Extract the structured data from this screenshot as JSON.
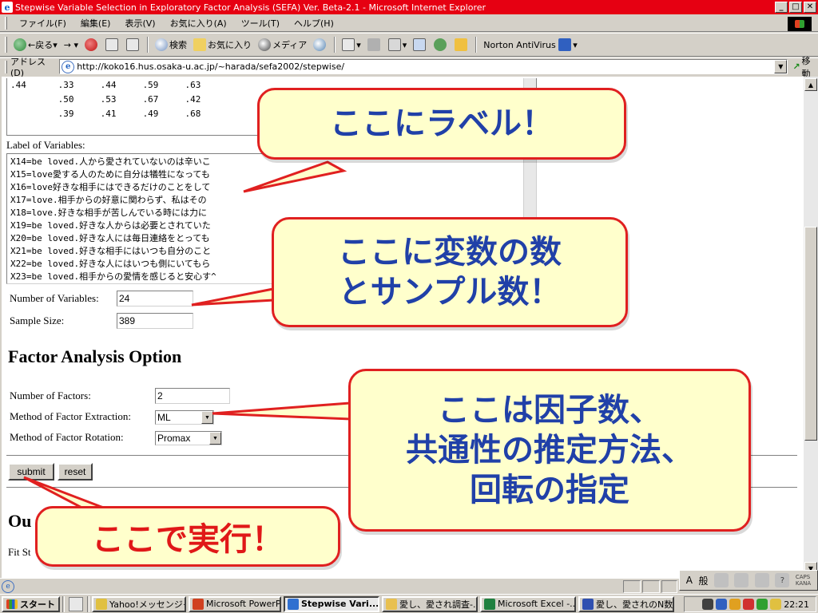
{
  "window": {
    "title": "Stepwise Variable Selection in Exploratory Factor Analysis (SEFA) Ver. Beta-2.1 - Microsoft Internet Explorer",
    "minimize": "_",
    "maximize": "□",
    "close": "✕"
  },
  "menu": {
    "items": [
      "ファイル(F)",
      "編集(E)",
      "表示(V)",
      "お気に入り(A)",
      "ツール(T)",
      "ヘルプ(H)"
    ]
  },
  "toolbar": {
    "back": "戻る",
    "search": "検索",
    "favorites": "お気に入り",
    "media": "メディア",
    "norton": "Norton AntiVirus"
  },
  "address": {
    "label": "アドレス(D)",
    "url": "http://koko16.hus.osaka-u.ac.jp/~harada/sefa2002/stepwise/",
    "go": "移動"
  },
  "form": {
    "corr_rows": [
      ".44      .33     .44     .59     .63",
      "         .50     .53     .67     .42",
      "         .39     .41     .49     .68"
    ],
    "label_of_variables": "Label of Variables:",
    "variable_labels": [
      "X14=be loved.人から愛されていないのは辛いこ",
      "X15=love愛する人のために自分は犠牲になっても",
      "X16=love好きな相手にはできるだけのことをして",
      "X17=love.相手からの好意に関わらず、私はその",
      "X18=love.好きな相手が苦しんでいる時には力に",
      "X19=be loved.好きな人からは必要とされていた",
      "X20=be loved.好きな人には毎日連絡をとっても",
      "X21=be loved.好きな相手にはいつも自分のこと",
      "X22=be loved.好きな人にはいつも側にいてもら",
      "X23=be loved.相手からの愛情を感じると安心す^"
    ],
    "num_variables_label": "Number of Variables:",
    "num_variables_value": "24",
    "sample_size_label": "Sample Size:",
    "sample_size_value": "389",
    "fa_heading": "Factor Analysis Option",
    "num_factors_label": "Number of Factors:",
    "num_factors_value": "2",
    "extraction_label": "Method of Factor Extraction:",
    "extraction_value": "ML",
    "rotation_label": "Method of Factor Rotation:",
    "rotation_value": "Promax",
    "submit": "submit",
    "reset": "reset",
    "output_heading_partial": "Ou",
    "fit_partial": "Fit St"
  },
  "callouts": {
    "label": "ここにラベル！",
    "vars_line1": "ここに変数の数",
    "vars_line2": "とサンプル数！",
    "factor_line1": "ここは因子数、",
    "factor_line2": "共通性の推定方法、",
    "factor_line3": "回転の指定",
    "run": "ここで実行！"
  },
  "ime": {
    "mode_a": "A",
    "mode_kanji": "般",
    "caps": "CAPS",
    "kana": "KANA"
  },
  "taskbar": {
    "start": "スタート",
    "tasks": [
      "Yahoo!メッセンジャー",
      "Microsoft PowerP...",
      "Stepwise Vari...",
      "愛し、愛され調査-...",
      "Microsoft Excel -...",
      "愛し、愛されのN数..."
    ],
    "clock": "22:21"
  },
  "colors": {
    "titlebar": "#e60012",
    "callout_border": "#e02020",
    "callout_fill": "#ffffcc",
    "callout_text_blue": "#2040a8",
    "callout_text_red": "#e01818"
  }
}
